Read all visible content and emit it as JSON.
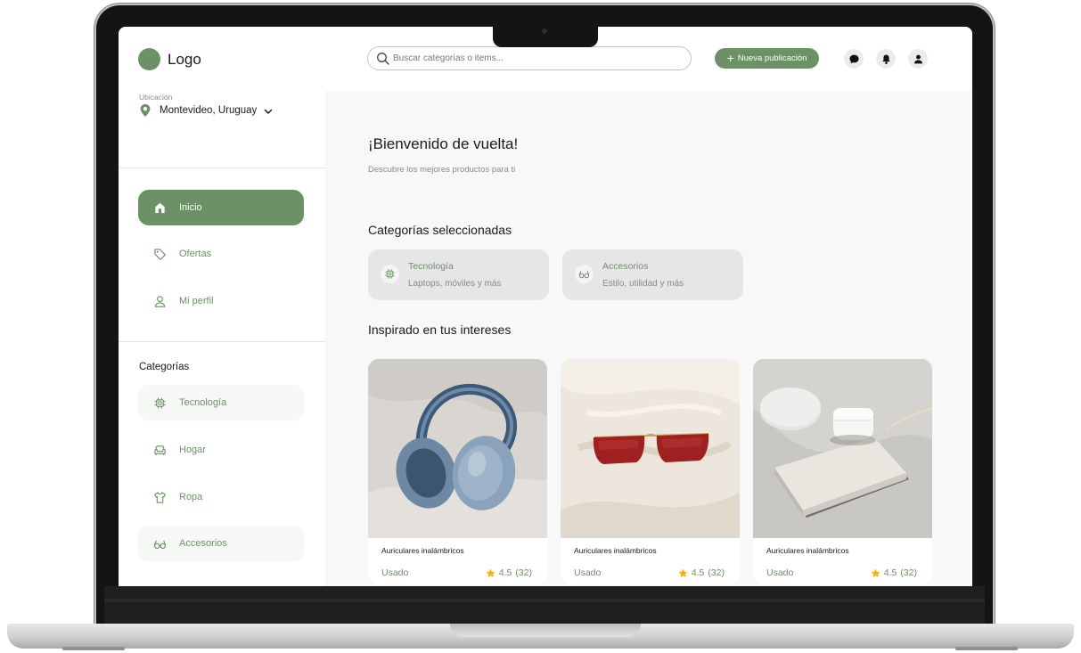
{
  "app": {
    "logo_text": "Logo",
    "brand_color": "#6c9167"
  },
  "header": {
    "search_placeholder": "Buscar categorías o items...",
    "new_post_label": "Nueva publicación",
    "icons": [
      "chat-icon",
      "bell-icon",
      "user-icon"
    ]
  },
  "location": {
    "label": "Ubicación",
    "value": "Montevideo, Uruguay"
  },
  "nav": {
    "items": [
      {
        "label": "Inicio",
        "icon": "home-icon",
        "active": true
      },
      {
        "label": "Ofertas",
        "icon": "tag-icon",
        "active": false
      },
      {
        "label": "Mi perfil",
        "icon": "user-icon",
        "active": false
      }
    ]
  },
  "categories_sidebar": {
    "heading": "Categorías",
    "items": [
      {
        "label": "Tecnología",
        "icon": "chip-icon"
      },
      {
        "label": "Hogar",
        "icon": "sofa-icon"
      },
      {
        "label": "Ropa",
        "icon": "shirt-icon"
      },
      {
        "label": "Accesorios",
        "icon": "glasses-icon"
      }
    ]
  },
  "main": {
    "welcome_title": "¡Bienvenido de vuelta!",
    "welcome_subtitle": "Descubre los mejores productos para ti",
    "selected_categories_title": "Categorías seleccionadas",
    "selected_categories": [
      {
        "title": "Tecnología",
        "subtitle": "Laptops, móviles y más",
        "icon": "chip-icon"
      },
      {
        "title": "Accesorios",
        "subtitle": "Estilo, utilidad y más",
        "icon": "glasses-icon"
      }
    ],
    "interests_title": "Inspirado en tus intereses",
    "products": [
      {
        "name": "Auriculares inalámbricos",
        "condition": "Usado",
        "rating": "4.5",
        "reviews": "(32)",
        "image": "headphones-image"
      },
      {
        "name": "Auriculares inalámbricos",
        "condition": "Usado",
        "rating": "4.5",
        "reviews": "(32)",
        "image": "sunglasses-image"
      },
      {
        "name": "Auriculares inalámbricos",
        "condition": "Usado",
        "rating": "4.5",
        "reviews": "(32)",
        "image": "earbuds-image"
      }
    ]
  }
}
